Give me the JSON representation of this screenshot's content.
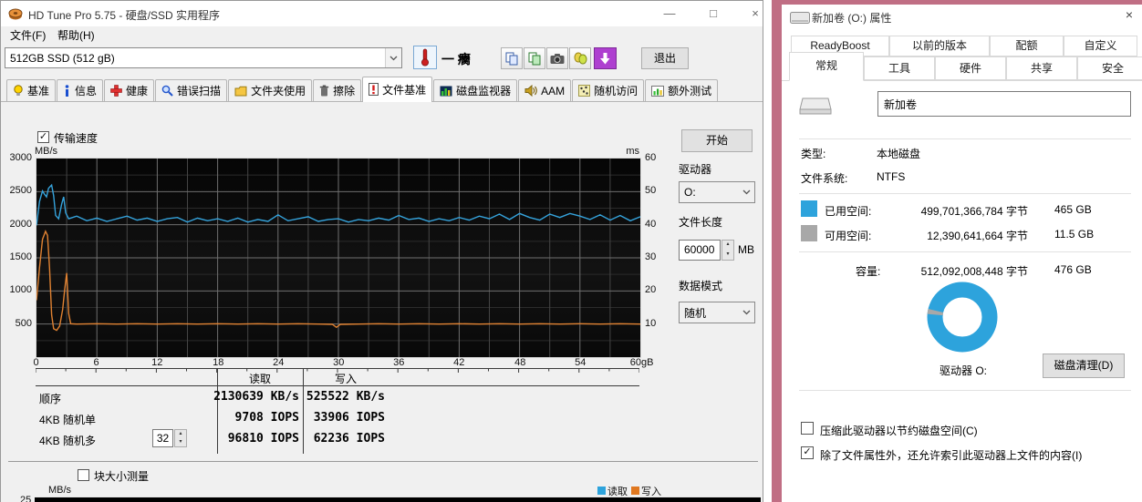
{
  "icons": {
    "minimize": "—",
    "maximize": "□",
    "close": "×",
    "check": "✓",
    "up": "▴",
    "down": "▾"
  },
  "hdtune": {
    "window_title": "HD Tune Pro 5.75 - 硬盘/SSD 实用程序",
    "menu": {
      "file": "文件(F)",
      "help": "帮助(H)"
    },
    "toolbar": {
      "drive_select": "512GB SSD (512 gB)",
      "temp_text": "一 癵",
      "exit": "退出"
    },
    "tabs": [
      "基准",
      "信息",
      "健康",
      "错误扫描",
      "文件夹使用",
      "擦除",
      "文件基准",
      "磁盘监视器",
      "AAM",
      "随机访问",
      "额外测试"
    ],
    "active_tab": "文件基准",
    "transfer_checkbox": "传输速度",
    "panel": {
      "start": "开始",
      "drive_label": "驱动器",
      "drive_value": "O:",
      "file_length_label": "文件长度",
      "file_length_value": "60000",
      "file_length_unit": "MB",
      "data_mode_label": "数据模式",
      "data_mode_value": "随机"
    },
    "results": {
      "col_read": "读取",
      "col_write": "写入",
      "queue_depth": "32",
      "rows": [
        {
          "label": "顺序",
          "read": "2130639 KB/s",
          "write": "525522 KB/s"
        },
        {
          "label": "4KB 随机单",
          "read": "9708 IOPS",
          "write": "33906 IOPS"
        },
        {
          "label": "4KB 随机多",
          "read": "96810 IOPS",
          "write": "62236 IOPS"
        }
      ]
    },
    "block_checkbox": "块大小测量",
    "legend": {
      "read": "读取",
      "write": "写入"
    },
    "bottom_chart": {
      "ylabel": "MB/s",
      "tick": "25"
    }
  },
  "chart_data": {
    "type": "line",
    "title": "传输速度",
    "xlabel": "gB",
    "ylabel_left": "MB/s",
    "ylabel_right": "ms",
    "xlim": [
      0,
      60
    ],
    "ylim_left": [
      0,
      3000
    ],
    "ylim_right": [
      0,
      60
    ],
    "x_ticks": [
      0,
      6,
      12,
      18,
      24,
      30,
      36,
      42,
      48,
      54,
      60
    ],
    "x_tick_labels": [
      "0",
      "6",
      "12",
      "18",
      "24",
      "30",
      "36",
      "42",
      "48",
      "54",
      "60gB"
    ],
    "y_ticks_left": [
      500,
      1000,
      1500,
      2000,
      2500,
      3000
    ],
    "y_ticks_right": [
      10,
      20,
      30,
      40,
      50,
      60
    ],
    "grid": true,
    "legend_position": "bottom-right",
    "series": [
      {
        "name": "读取",
        "color": "#35a3dc",
        "points": [
          [
            0,
            1990
          ],
          [
            0.3,
            2350
          ],
          [
            0.6,
            2510
          ],
          [
            0.8,
            2460
          ],
          [
            1,
            2420
          ],
          [
            1.2,
            2550
          ],
          [
            1.5,
            2600
          ],
          [
            1.7,
            2440
          ],
          [
            1.9,
            2140
          ],
          [
            2.2,
            2090
          ],
          [
            2.5,
            2310
          ],
          [
            2.7,
            2420
          ],
          [
            2.9,
            2180
          ],
          [
            3.2,
            2090
          ],
          [
            4,
            2130
          ],
          [
            5,
            2060
          ],
          [
            6,
            2100
          ],
          [
            7,
            2050
          ],
          [
            8,
            2090
          ],
          [
            9,
            2130
          ],
          [
            10,
            2070
          ],
          [
            11,
            2100
          ],
          [
            12,
            2050
          ],
          [
            13,
            2090
          ],
          [
            14,
            2110
          ],
          [
            15,
            2040
          ],
          [
            16,
            2100
          ],
          [
            17,
            2060
          ],
          [
            18,
            2090
          ],
          [
            19,
            2050
          ],
          [
            20,
            2100
          ],
          [
            21,
            2040
          ],
          [
            22,
            2080
          ],
          [
            23,
            2050
          ],
          [
            24,
            2150
          ],
          [
            25,
            2060
          ],
          [
            26,
            2090
          ],
          [
            27,
            2120
          ],
          [
            28,
            2050
          ],
          [
            29,
            2080
          ],
          [
            30,
            2090
          ],
          [
            31,
            2040
          ],
          [
            32,
            2080
          ],
          [
            33,
            2060
          ],
          [
            34,
            2100
          ],
          [
            35,
            2070
          ],
          [
            36,
            2140
          ],
          [
            37,
            2080
          ],
          [
            38,
            2100
          ],
          [
            39,
            2050
          ],
          [
            40,
            2090
          ],
          [
            41,
            2060
          ],
          [
            42,
            2110
          ],
          [
            43,
            2070
          ],
          [
            44,
            2130
          ],
          [
            45,
            2090
          ],
          [
            46,
            2160
          ],
          [
            47,
            2080
          ],
          [
            48,
            2170
          ],
          [
            49,
            2110
          ],
          [
            50,
            2070
          ],
          [
            51,
            2160
          ],
          [
            52,
            2110
          ],
          [
            53,
            2170
          ],
          [
            54,
            2130
          ],
          [
            55,
            2080
          ],
          [
            56,
            2150
          ],
          [
            57,
            2070
          ],
          [
            58,
            2140
          ],
          [
            59,
            2060
          ],
          [
            60,
            2120
          ]
        ]
      },
      {
        "name": "写入",
        "color": "#e08232",
        "points": [
          [
            0,
            860
          ],
          [
            0.3,
            1350
          ],
          [
            0.6,
            1780
          ],
          [
            0.9,
            1900
          ],
          [
            1.1,
            1840
          ],
          [
            1.3,
            1350
          ],
          [
            1.5,
            640
          ],
          [
            1.7,
            430
          ],
          [
            2,
            405
          ],
          [
            2.3,
            470
          ],
          [
            2.6,
            720
          ],
          [
            2.8,
            1020
          ],
          [
            3,
            1270
          ],
          [
            3.2,
            660
          ],
          [
            3.4,
            505
          ],
          [
            4,
            500
          ],
          [
            6,
            505
          ],
          [
            8,
            500
          ],
          [
            10,
            505
          ],
          [
            12,
            500
          ],
          [
            14,
            505
          ],
          [
            16,
            500
          ],
          [
            18,
            505
          ],
          [
            20,
            500
          ],
          [
            22,
            505
          ],
          [
            24,
            500
          ],
          [
            26,
            505
          ],
          [
            28,
            500
          ],
          [
            29.4,
            495
          ],
          [
            29.8,
            450
          ],
          [
            30.2,
            495
          ],
          [
            32,
            500
          ],
          [
            34,
            505
          ],
          [
            36,
            500
          ],
          [
            38,
            505
          ],
          [
            40,
            500
          ],
          [
            42,
            505
          ],
          [
            44,
            500
          ],
          [
            46,
            505
          ],
          [
            48,
            500
          ],
          [
            50,
            505
          ],
          [
            52,
            500
          ],
          [
            54,
            505
          ],
          [
            56,
            500
          ],
          [
            58,
            505
          ],
          [
            60,
            500
          ]
        ]
      }
    ]
  },
  "properties": {
    "window_title": "新加卷 (O:) 属性",
    "tabs_row1": [
      "ReadyBoost",
      "以前的版本",
      "配额",
      "自定义"
    ],
    "tabs_row2": [
      "常规",
      "工具",
      "硬件",
      "共享",
      "安全"
    ],
    "active_tab": "常规",
    "volume_name": "新加卷",
    "fields": {
      "type_label": "类型:",
      "type_value": "本地磁盘",
      "fs_label": "文件系统:",
      "fs_value": "NTFS"
    },
    "space": {
      "used_label": "已用空间:",
      "used_bytes": "499,701,366,784 字节",
      "used_size": "465 GB",
      "free_label": "可用空间:",
      "free_bytes": "12,390,641,664 字节",
      "free_size": "11.5 GB",
      "capacity_label": "容量:",
      "capacity_bytes": "512,092,008,448 字节",
      "capacity_size": "476 GB",
      "used_pct": 97.6
    },
    "drive_caption": "驱动器 O:",
    "cleanup_button": "磁盘清理(D)",
    "compress_checkbox": "压缩此驱动器以节约磁盘空间(C)",
    "index_checkbox": "除了文件属性外，还允许索引此驱动器上文件的内容(I)",
    "colors": {
      "used": "#2da3dc",
      "free": "#a8a8a8",
      "frame": "#c06e84"
    }
  }
}
